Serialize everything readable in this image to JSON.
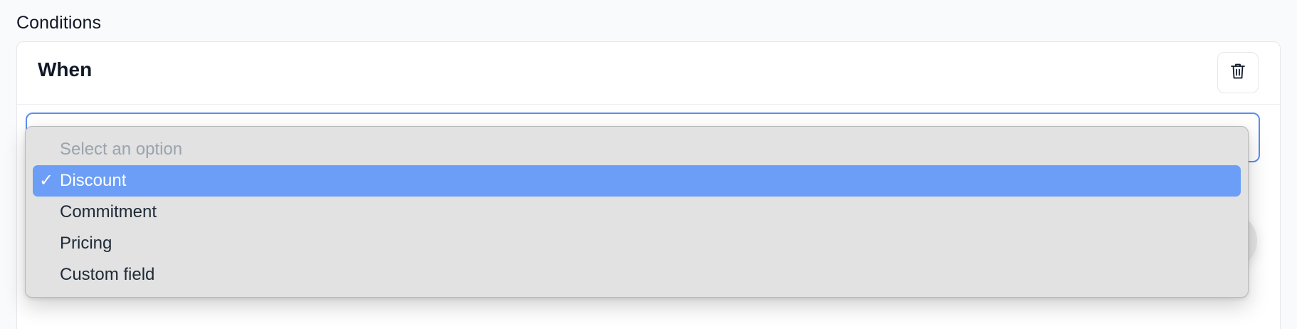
{
  "section": {
    "label": "Conditions"
  },
  "card": {
    "title": "When",
    "delete_icon": "trash-icon"
  },
  "dropdown": {
    "placeholder": "Select an option",
    "selected_index": 0,
    "check_mark": "✓",
    "options": [
      {
        "label": "Discount",
        "selected": true
      },
      {
        "label": "Commitment",
        "selected": false
      },
      {
        "label": "Pricing",
        "selected": false
      },
      {
        "label": "Custom field",
        "selected": false
      }
    ]
  },
  "colors": {
    "selected_bg": "#6c9ef7",
    "menu_bg": "#e1e2e1",
    "focus_border": "#5b8def"
  }
}
